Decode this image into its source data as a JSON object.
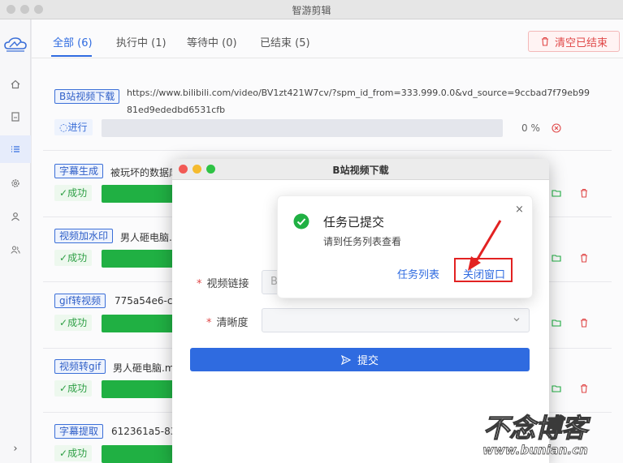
{
  "window": {
    "title": "智游剪辑"
  },
  "sidebar": {
    "items": [
      {
        "icon": "home-icon"
      },
      {
        "icon": "document-icon"
      },
      {
        "icon": "list-icon"
      },
      {
        "icon": "settings-icon"
      },
      {
        "icon": "user-icon"
      },
      {
        "icon": "users-icon"
      }
    ],
    "expand_glyph": "›"
  },
  "tabs": [
    {
      "label": "全部 (6)"
    },
    {
      "label": "执行中 (1)"
    },
    {
      "label": "等待中 (0)"
    },
    {
      "label": "已结束 (5)"
    }
  ],
  "toolbar": {
    "clear_label": "清空已结束"
  },
  "tasks": [
    {
      "tag": "B站视频下载",
      "title": "https://www.bilibili.com/video/BV1zt421W7cv/?spm_id_from=333.999.0.0&vd_source=9ccbad7f79eb9981ed9ededbd6531cfb",
      "status": "进行",
      "progress": 0,
      "percent_label": "0 %"
    },
    {
      "tag": "字幕生成",
      "title": "被玩坏的数据库",
      "status": "成功",
      "progress": 1
    },
    {
      "tag": "视频加水印",
      "title": "男人砸电脑.r",
      "status": "成功",
      "progress": 1
    },
    {
      "tag": "gif转视频",
      "title": "775a54e6-cb",
      "status": "成功",
      "progress": 1
    },
    {
      "tag": "视频转gif",
      "title": "男人砸电脑.m",
      "status": "成功",
      "progress": 1
    },
    {
      "tag": "字幕提取",
      "title": "612361a5-83",
      "status": "成功",
      "progress": 1
    }
  ],
  "modal": {
    "title": "B站视频下载",
    "link_label": "视频链接",
    "link_value": "B",
    "quality_label": "清晰度",
    "required_mark": "*",
    "submit_label": "提交"
  },
  "popup": {
    "title": "任务已提交",
    "message": "请到任务列表查看",
    "task_list_link": "任务列表",
    "close_window_link": "关闭窗口",
    "close_glyph": "×"
  },
  "watermark": {
    "line1": "不念博客",
    "line2": "www.bunian.cn"
  },
  "colors": {
    "accent": "#2f6be0",
    "success": "#20b043",
    "danger": "#e04848",
    "highlight": "#e22222"
  }
}
